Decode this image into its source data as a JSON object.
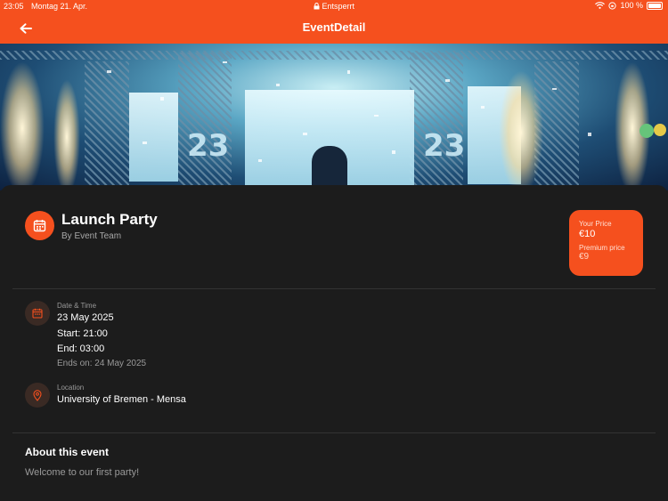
{
  "status_bar": {
    "time": "23:05",
    "date": "Montag 21. Apr.",
    "lock_status": "Entsperrt",
    "battery": "100 %"
  },
  "app_bar": {
    "title": "EventDetail",
    "back_icon": "arrow-left-icon"
  },
  "event": {
    "title": "Launch Party",
    "organizer": "By Event Team",
    "icon": "calendar-icon"
  },
  "price": {
    "label": "Your Price",
    "value": "€10",
    "premium_label": "Premium price",
    "premium_value": "€9"
  },
  "details": {
    "datetime_label": "Date & Time",
    "date": "23 May 2025",
    "start": "Start: 21:00",
    "end": "End: 03:00",
    "ends_on": "Ends on: 24 May 2025",
    "location_label": "Location",
    "location": "University of Bremen - Mensa"
  },
  "about": {
    "heading": "About this event",
    "text": "Welcome to our first party!"
  },
  "colors": {
    "accent": "#f5501e",
    "background": "#1c1c1c"
  }
}
